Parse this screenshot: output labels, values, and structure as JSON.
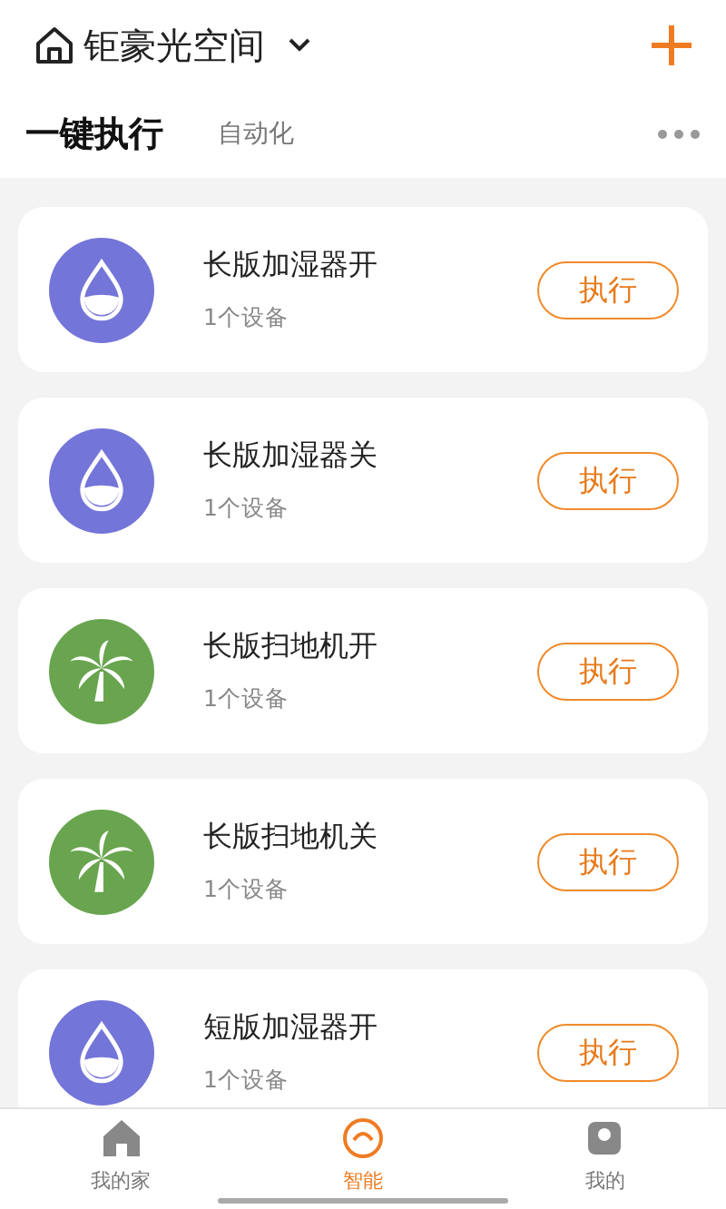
{
  "header": {
    "home_name": "钜豪光空间"
  },
  "tabs": [
    {
      "label": "一键执行",
      "selected": true
    },
    {
      "label": "自动化",
      "selected": false
    }
  ],
  "scenes": [
    {
      "name": "长版加湿器开",
      "devices": "1个设备",
      "kind": "drop",
      "color": "#7475d8",
      "action": "执行"
    },
    {
      "name": "长版加湿器关",
      "devices": "1个设备",
      "kind": "drop",
      "color": "#7475d8",
      "action": "执行"
    },
    {
      "name": "长版扫地机开",
      "devices": "1个设备",
      "kind": "palm",
      "color": "#69a54f",
      "action": "执行"
    },
    {
      "name": "长版扫地机关",
      "devices": "1个设备",
      "kind": "palm",
      "color": "#69a54f",
      "action": "执行"
    },
    {
      "name": "短版加湿器开",
      "devices": "1个设备",
      "kind": "drop",
      "color": "#7475d8",
      "action": "执行"
    }
  ],
  "bottom_nav": [
    {
      "label": "我的家",
      "kind": "home",
      "selected": false
    },
    {
      "label": "智能",
      "kind": "smart",
      "selected": true
    },
    {
      "label": "我的",
      "kind": "me",
      "selected": false
    }
  ]
}
